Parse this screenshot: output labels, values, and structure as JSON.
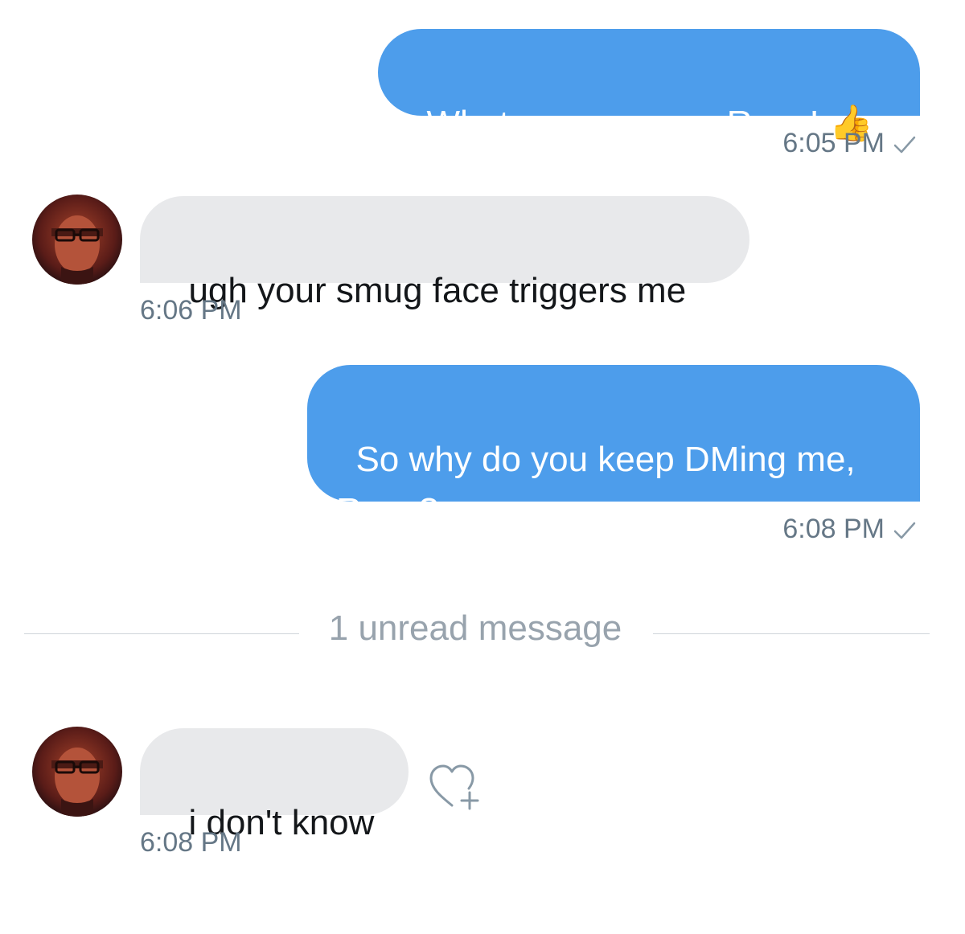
{
  "messages": [
    {
      "direction": "sent",
      "text": "Whatever you say, Ryan! 👍",
      "time": "6:05 PM"
    },
    {
      "direction": "received",
      "text": "ugh your smug face triggers me",
      "time": "6:06 PM"
    },
    {
      "direction": "sent",
      "text": "So why do you keep DMing me, Ryan?",
      "time": "6:08 PM"
    },
    {
      "direction": "received",
      "text": "i don't know",
      "time": "6:08 PM"
    }
  ],
  "unread_divider": "1 unread message",
  "icons": {
    "read_receipt": "checkmark-icon",
    "like": "heart-plus-icon",
    "avatar": "user-avatar"
  },
  "colors": {
    "sent_bubble": "#4d9deb",
    "received_bubble": "#e8e9eb",
    "timestamp": "#657786",
    "divider_text": "#98a3ad"
  }
}
